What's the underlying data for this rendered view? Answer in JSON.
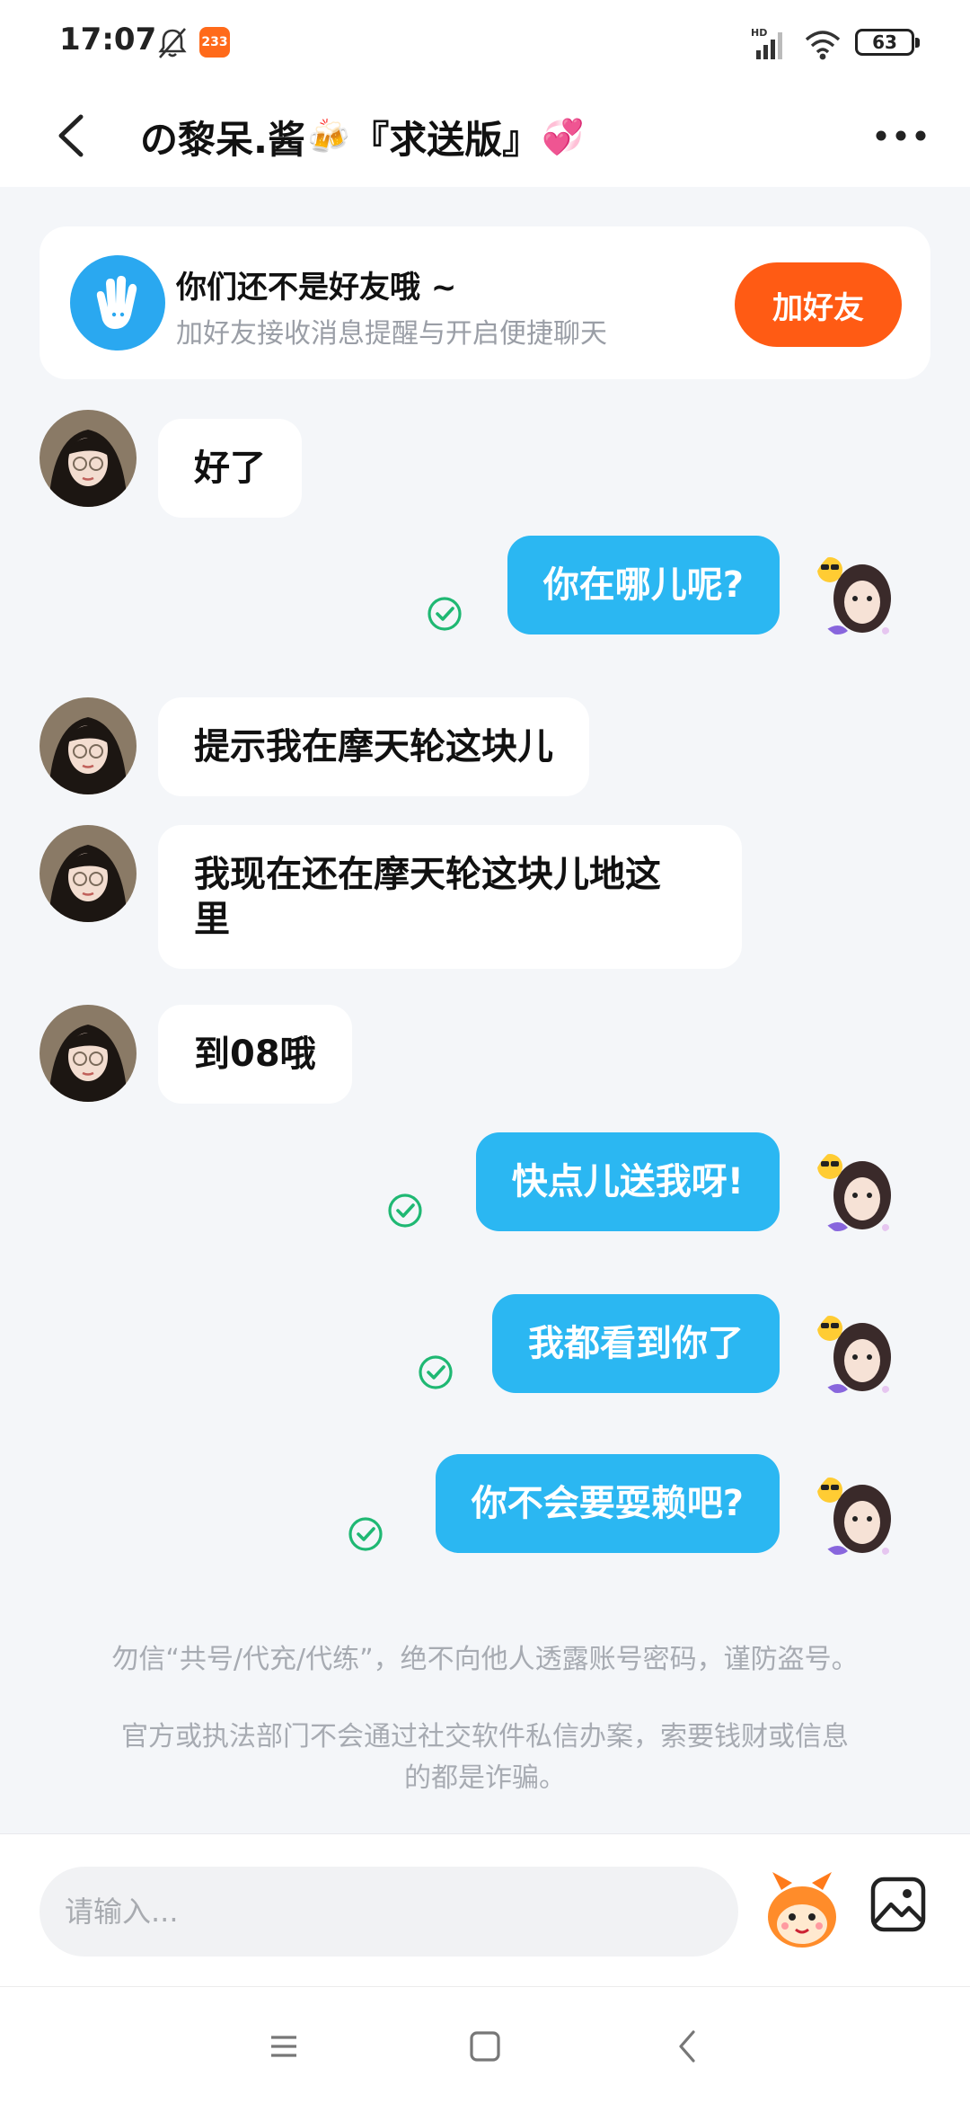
{
  "status_bar": {
    "time": "17:07",
    "app_badge": "233",
    "battery": "63",
    "network": "HD"
  },
  "header": {
    "title_part1": "の黎呆.酱",
    "title_emoji1": "🍻",
    "title_part2": "『求送版』",
    "title_emoji2": "💞"
  },
  "friend_banner": {
    "title": "你们还不是好友哦 ~",
    "subtitle": "加好友接收消息提醒与开启便捷聊天",
    "button_label": "加好友"
  },
  "messages": [
    {
      "side": "in",
      "text": "好了"
    },
    {
      "side": "out",
      "text": "你在哪儿呢?"
    },
    {
      "side": "in",
      "text": "提示我在摩天轮这块儿"
    },
    {
      "side": "in",
      "text_line1": "我现在还在摩天轮这块儿地这",
      "text_line2": "里"
    },
    {
      "side": "in",
      "text": "到08哦"
    },
    {
      "side": "out",
      "text": "快点儿送我呀!"
    },
    {
      "side": "out",
      "text": "我都看到你了"
    },
    {
      "side": "out",
      "text": "你不会要耍赖吧?"
    }
  ],
  "notices": {
    "line1": "勿信“共号/代充/代练”，绝不向他人透露账号密码，谨防盗号。",
    "line2a": "官方或执法部门不会通过社交软件私信办案，索要钱财或信息",
    "line2b": "的都是诈骗。"
  },
  "input": {
    "placeholder": "请输入..."
  },
  "colors": {
    "accent_blue": "#2bb7f2",
    "accent_orange": "#ff5b14",
    "read_green": "#1fb873",
    "background": "#f4f6f9"
  }
}
